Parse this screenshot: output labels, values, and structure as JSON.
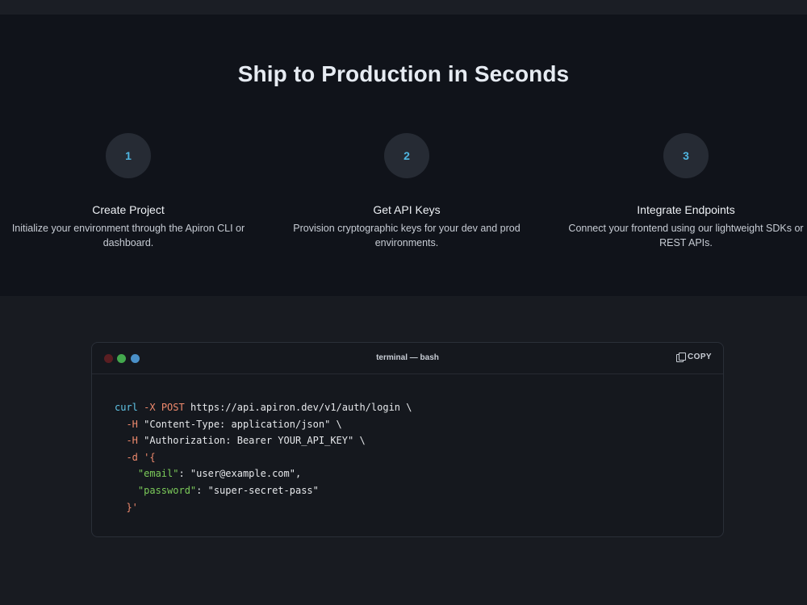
{
  "section": {
    "title": "Ship to Production in Seconds"
  },
  "steps": [
    {
      "number": "1",
      "title": "Create Project",
      "description": "Initialize your environment through the Apiron CLI or dashboard."
    },
    {
      "number": "2",
      "title": "Get API Keys",
      "description": "Provision cryptographic keys for your dev and prod environments."
    },
    {
      "number": "3",
      "title": "Integrate Endpoints",
      "description": "Connect your frontend using our lightweight SDKs or REST APIs."
    }
  ],
  "terminal": {
    "title": "terminal — bash",
    "copy_label": "COPY",
    "code": {
      "l1_cmd": "curl",
      "l1_flag": "-X POST",
      "l1_rest": " https://api.apiron.dev/v1/auth/login \\",
      "l2_flag": "-H",
      "l2_rest": " \"Content-Type: application/json\" \\",
      "l3_flag": "-H",
      "l3_rest": " \"Authorization: Bearer YOUR_API_KEY\" \\",
      "l4_flag": "-d",
      "l4_rest": " '{",
      "l5_key": "\"email\"",
      "l5_rest": ": \"user@example.com\",",
      "l6_key": "\"password\"",
      "l6_rest": ": \"super-secret-pass\"",
      "l7": "}'"
    }
  },
  "colors": {
    "accent": "#4fb5e0",
    "flag": "#f08a6d",
    "json_key": "#7ccb5a"
  }
}
